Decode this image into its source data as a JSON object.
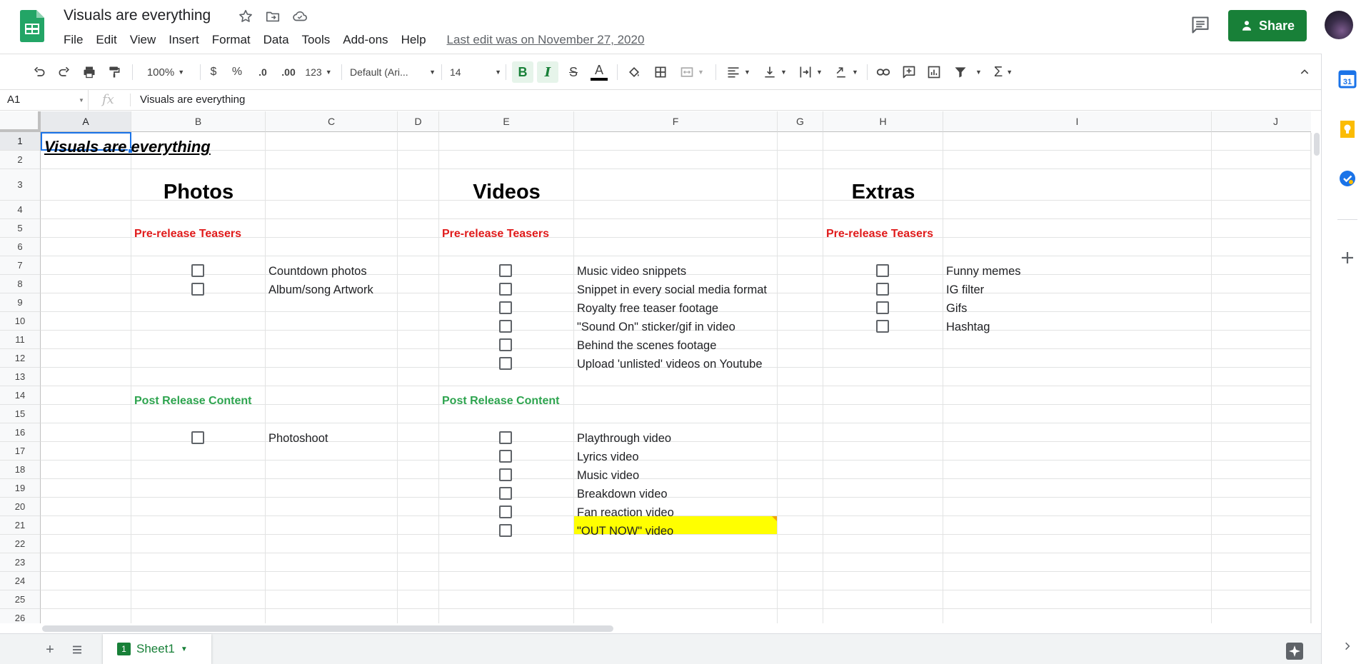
{
  "header": {
    "title": "Visuals are everything",
    "menus": [
      "File",
      "Edit",
      "View",
      "Insert",
      "Format",
      "Data",
      "Tools",
      "Add-ons",
      "Help"
    ],
    "last_edit": "Last edit was on November 27, 2020",
    "share_label": "Share"
  },
  "toolbar": {
    "zoom": "100%",
    "currency": "$",
    "percent": "%",
    "dec_decrease": ".0",
    "dec_increase": ".00",
    "more_formats": "123",
    "font": "Default (Ari...",
    "font_size": "14"
  },
  "formula_bar": {
    "cell_ref": "A1",
    "fx": "fx",
    "value": "Visuals are everything"
  },
  "columns": [
    "A",
    "B",
    "C",
    "D",
    "E",
    "F",
    "G",
    "H",
    "I",
    "J"
  ],
  "rows": [
    "1",
    "2",
    "3",
    "4",
    "5",
    "6",
    "7",
    "8",
    "9",
    "10",
    "11",
    "12",
    "13",
    "14",
    "15",
    "16",
    "17",
    "18",
    "19",
    "20",
    "21",
    "22",
    "23",
    "24",
    "25",
    "26"
  ],
  "sheet": {
    "title": "Visuals are everything",
    "photos": {
      "heading": "Photos",
      "pre_label": "Pre-release Teasers",
      "pre_items": [
        "Countdown photos",
        "Album/song Artwork"
      ],
      "post_label": "Post Release Content",
      "post_items": [
        "Photoshoot"
      ]
    },
    "videos": {
      "heading": "Videos",
      "pre_label": "Pre-release Teasers",
      "pre_items": [
        "Music video snippets",
        "Snippet in every social media format",
        "Royalty free teaser footage",
        "\"Sound On\" sticker/gif in video",
        "Behind the scenes footage",
        "Upload 'unlisted' videos on Youtube"
      ],
      "post_label": "Post Release Content",
      "post_items": [
        "Playthrough video",
        "Lyrics video",
        "Music video",
        "Breakdown video",
        "Fan reaction video",
        "\"OUT NOW\" video"
      ]
    },
    "extras": {
      "heading": "Extras",
      "pre_label": "Pre-release Teasers",
      "pre_items": [
        "Funny memes",
        "IG filter",
        "Gifs",
        "Hashtag"
      ]
    }
  },
  "bottom": {
    "sheet_tab": "Sheet1",
    "tab_num": "1"
  },
  "colors": {
    "brand_green": "#188038",
    "red_label": "#e01b1b",
    "green_label": "#2ea44f",
    "highlight": "#ffff00",
    "selection": "#1a73e8"
  }
}
